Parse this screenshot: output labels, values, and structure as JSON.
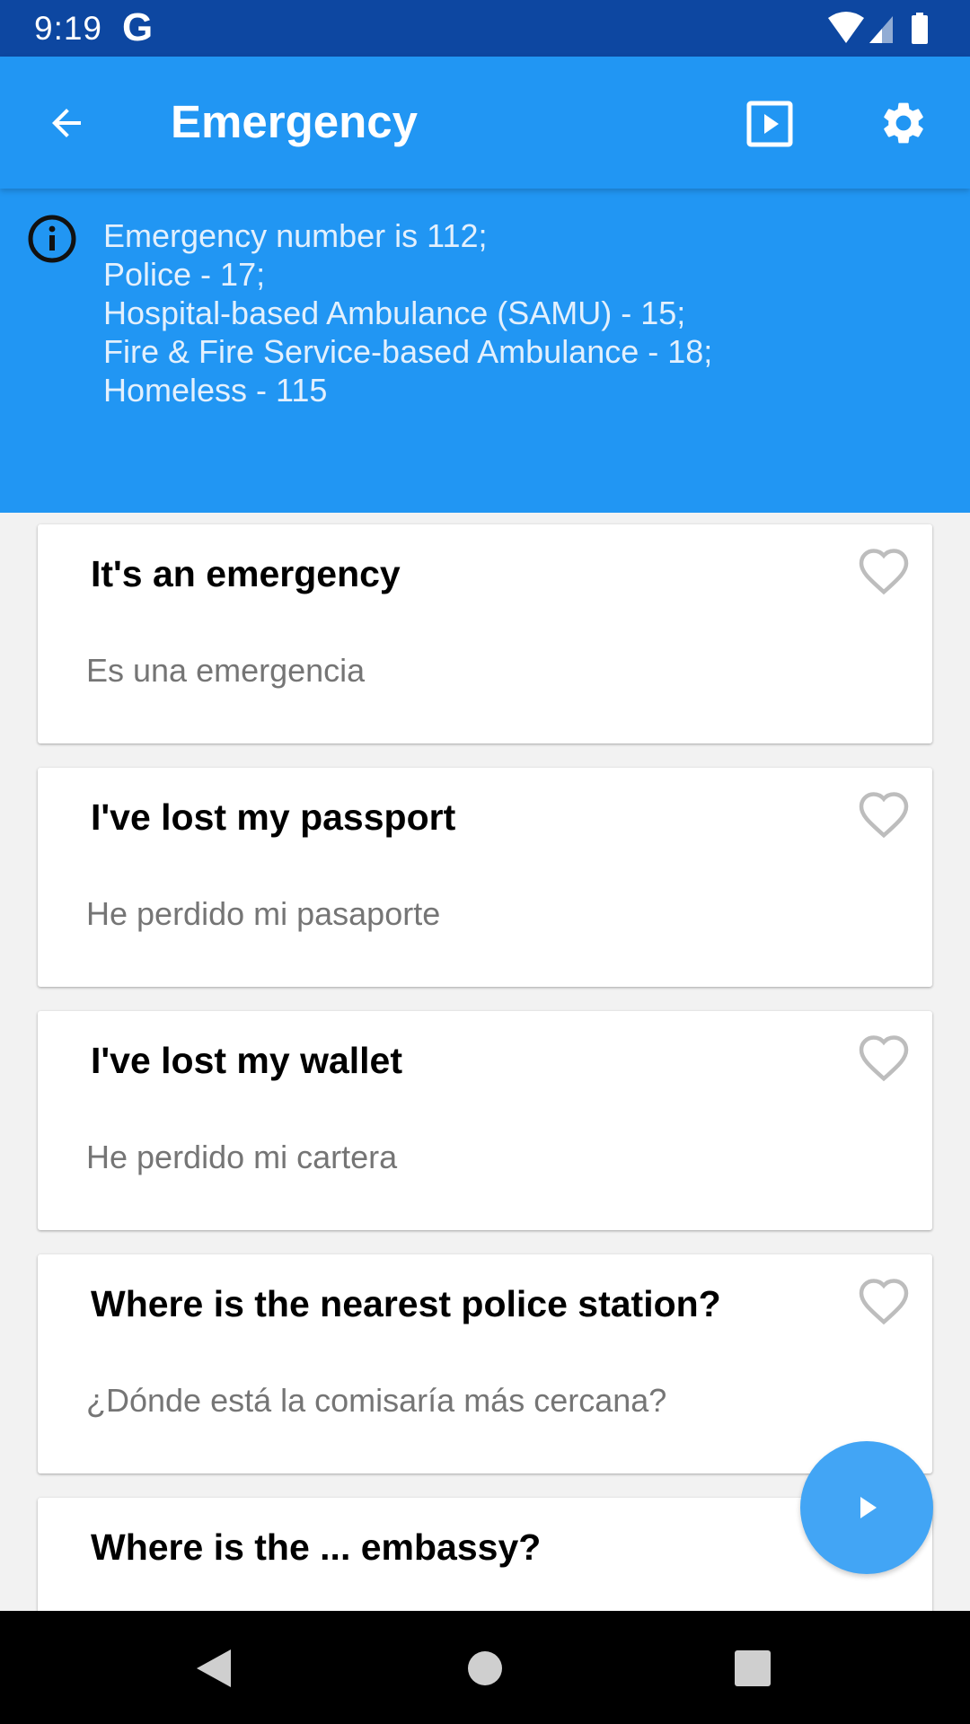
{
  "status_bar": {
    "time": "9:19",
    "g_label": "G",
    "icons": [
      "wifi-icon",
      "signal-icon",
      "battery-icon"
    ]
  },
  "app_bar": {
    "title": "Emergency",
    "icons": [
      "arrow-back-icon",
      "play-box-icon",
      "gear-icon"
    ]
  },
  "info": {
    "icon": "info-circle-icon",
    "lines": [
      "Emergency number is 112;",
      "Police - 17;",
      "Hospital-based Ambulance (SAMU) - 15;",
      "Fire & Fire Service-based Ambulance - 18;",
      "Homeless - 115"
    ]
  },
  "phrases": [
    {
      "english": "It's an emergency",
      "translation": "Es una emergencia"
    },
    {
      "english": "I've lost my passport",
      "translation": "He perdido mi pasaporte"
    },
    {
      "english": "I've lost my wallet",
      "translation": "He perdido mi cartera"
    },
    {
      "english": "Where is the nearest police station?",
      "translation": "¿Dónde está la comisaría  más cercana?"
    },
    {
      "english": "Where is the ... embassy?",
      "translation": ""
    }
  ],
  "colors": {
    "status_bar": "#0d47a1",
    "primary": "#2196f3",
    "fab": "#42a5f5",
    "heart_outline": "#bdbdbd",
    "translation_text": "#757575"
  }
}
